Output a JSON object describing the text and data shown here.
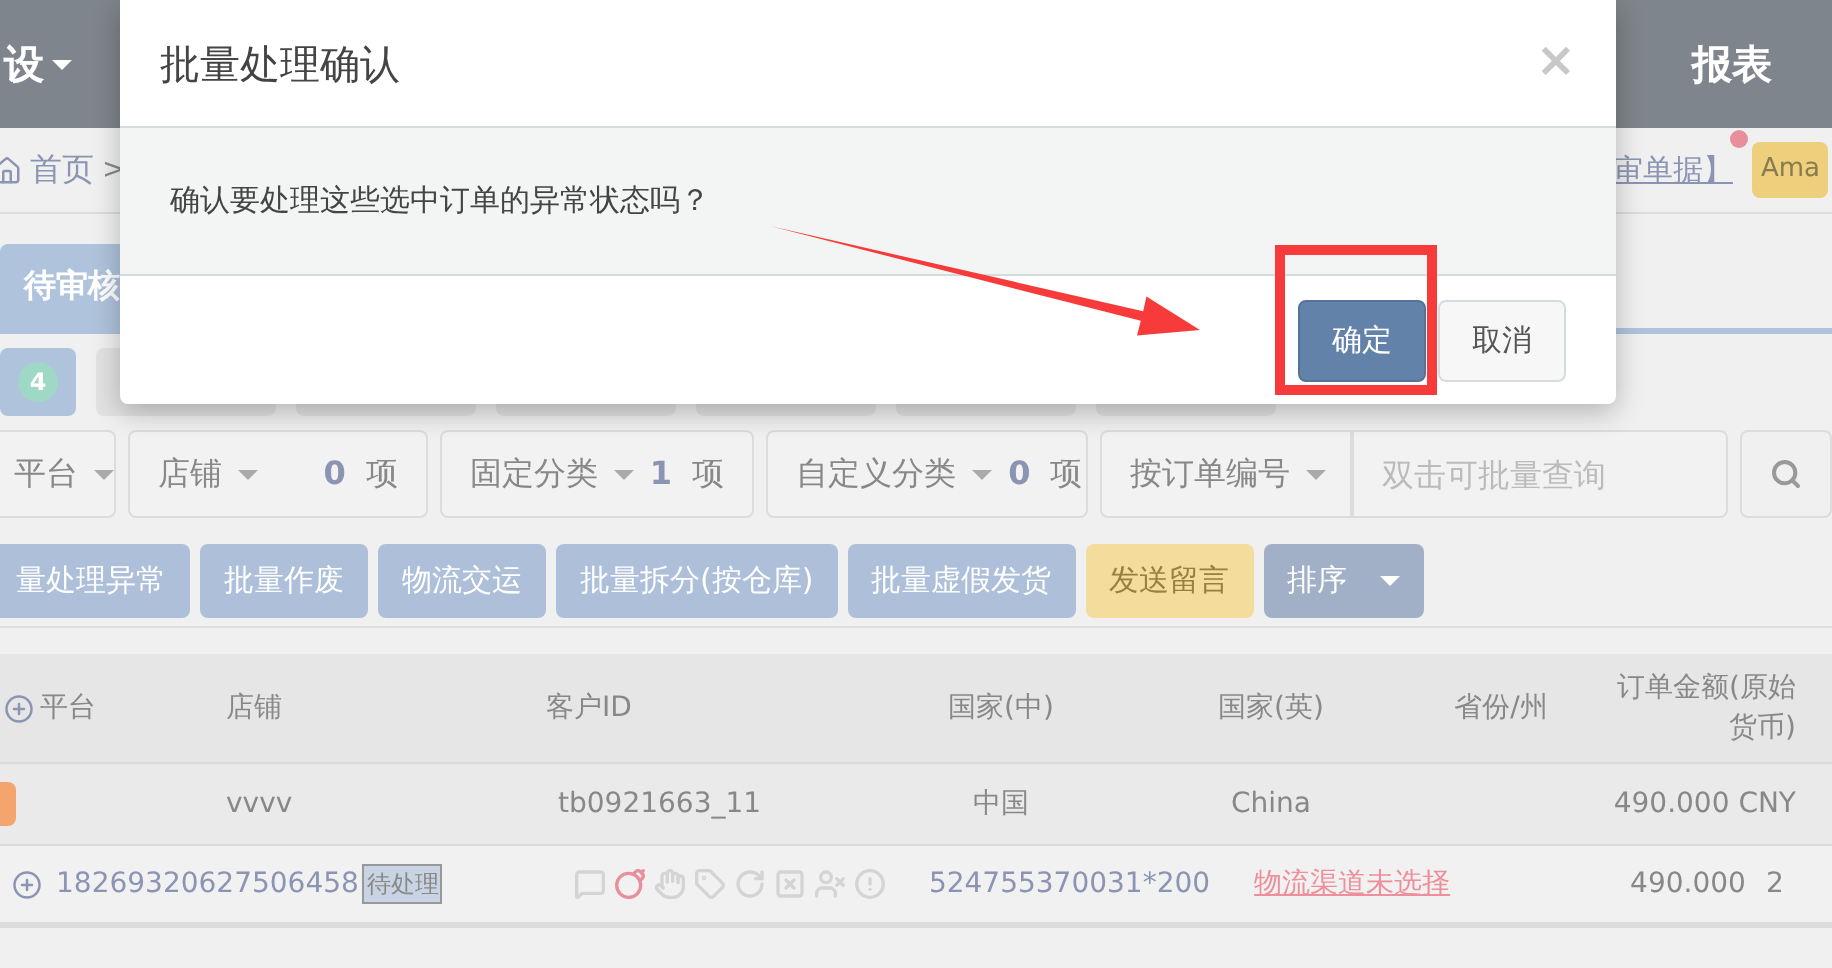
{
  "top_nav": {
    "left_item": "设",
    "right_item": "报表"
  },
  "breadcrumb": {
    "home": "首页",
    "separator": ">",
    "link": "审单据】",
    "badge": "Ama"
  },
  "status_tab": {
    "label": "待审核",
    "selected": true
  },
  "step_tabs": [
    {
      "count": "4",
      "selected": true
    },
    {
      "selected": false
    },
    {
      "selected": false
    },
    {
      "selected": false
    },
    {
      "selected": false
    },
    {
      "selected": false
    },
    {
      "selected": false
    }
  ],
  "filters": [
    {
      "label": "平台"
    },
    {
      "label": "店铺",
      "count": "0",
      "unit": "项"
    },
    {
      "label": "固定分类",
      "count": "1",
      "unit": "项"
    },
    {
      "label": "自定义分类",
      "count": "0",
      "unit": "项"
    },
    {
      "label": "按订单编号"
    }
  ],
  "search": {
    "placeholder": "双击可批量查询"
  },
  "actions": [
    {
      "label": "量处理异常",
      "kind": "primary"
    },
    {
      "label": "批量作废",
      "kind": "primary"
    },
    {
      "label": "物流交运",
      "kind": "primary"
    },
    {
      "label": "批量拆分(按仓库)",
      "kind": "primary"
    },
    {
      "label": "批量虚假发货",
      "kind": "primary"
    },
    {
      "label": "发送留言",
      "kind": "warning"
    },
    {
      "label": "排序",
      "kind": "dropdown"
    }
  ],
  "table": {
    "columns": [
      "平台",
      "店铺",
      "客户ID",
      "国家(中)",
      "国家(英)",
      "省份/州",
      "订单金额(原始货币)"
    ],
    "order": {
      "cells": [
        "",
        "vvvv",
        "tb0921663_11",
        "中国",
        "China",
        "",
        "490.000 CNY"
      ]
    },
    "item": {
      "order_no": "18269320627506458",
      "status": "待处理",
      "flags": [
        {
          "kind": "message",
          "on": false
        },
        {
          "kind": "bomb",
          "on": true
        },
        {
          "kind": "hand",
          "on": false
        },
        {
          "kind": "tag",
          "on": false
        },
        {
          "kind": "refresh",
          "on": false
        },
        {
          "kind": "cards",
          "on": false
        },
        {
          "kind": "user",
          "on": false
        },
        {
          "kind": "alert",
          "on": false
        }
      ],
      "sku": "524755370031*200",
      "logistics_link": "物流渠道未选择",
      "amount": "490.000",
      "column_9": "2"
    }
  },
  "dialog": {
    "title": "批量处理确认",
    "close": "×",
    "message": "确认要处理这些选中订单的异常状态吗？",
    "buttons": [
      {
        "label": "确定",
        "kind": "primary"
      },
      {
        "label": "取消",
        "kind": "default"
      }
    ]
  }
}
